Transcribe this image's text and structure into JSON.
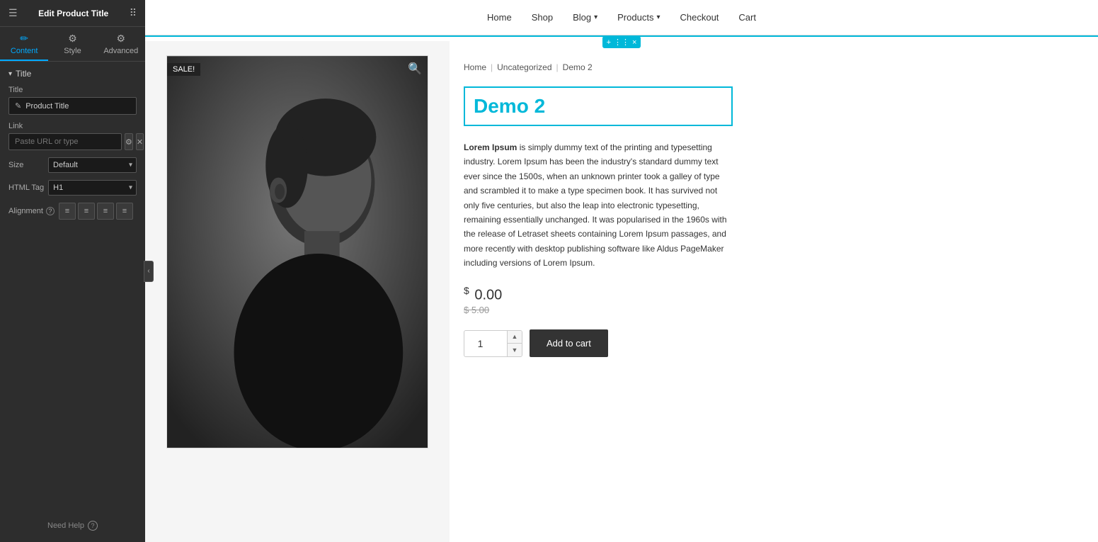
{
  "sidebar": {
    "header_title": "Edit Product Title",
    "tabs": [
      {
        "id": "content",
        "label": "Content",
        "active": true
      },
      {
        "id": "style",
        "label": "Style",
        "active": false
      },
      {
        "id": "advanced",
        "label": "Advanced",
        "active": false
      }
    ],
    "section_title": "Title",
    "fields": {
      "title_label": "Title",
      "title_value": "Product Title",
      "link_label": "Link",
      "link_placeholder": "Paste URL or type",
      "size_label": "Size",
      "size_value": "Default",
      "html_tag_label": "HTML Tag",
      "html_tag_value": "H1",
      "alignment_label": "Alignment"
    },
    "need_help_label": "Need Help"
  },
  "nav": {
    "items": [
      {
        "label": "Home",
        "has_arrow": false
      },
      {
        "label": "Shop",
        "has_arrow": false
      },
      {
        "label": "Blog",
        "has_arrow": true
      },
      {
        "label": "Products",
        "has_arrow": true
      },
      {
        "label": "Checkout",
        "has_arrow": false
      },
      {
        "label": "Cart",
        "has_arrow": false
      }
    ]
  },
  "product": {
    "breadcrumb": [
      "Home",
      "Uncategorized",
      "Demo 2"
    ],
    "title": "Demo 2",
    "sale_badge": "SALE!",
    "price_current": "0.00",
    "price_currency": "$",
    "price_old": "$ 5.00",
    "quantity": "1",
    "add_to_cart_label": "Add to cart",
    "description": "Lorem Ipsum is simply dummy text of the printing and typesetting industry. Lorem Ipsum has been the industry's standard dummy text ever since the 1500s, when an unknown printer took a galley of type and scrambled it to make a type specimen book. It has survived not only five centuries, but also the leap into electronic typesetting, remaining essentially unchanged. It was popularised in the 1960s with the release of Letraset sheets containing Lorem Ipsum passages, and more recently with desktop publishing software like Aldus PageMaker including versions of Lorem Ipsum."
  },
  "toolbar": {
    "plus_label": "+",
    "grid_label": "⋮⋮",
    "close_label": "×"
  },
  "colors": {
    "accent": "#00b8d9",
    "sidebar_bg": "#2d2d2d",
    "dark_bg": "#1a1a1a"
  }
}
